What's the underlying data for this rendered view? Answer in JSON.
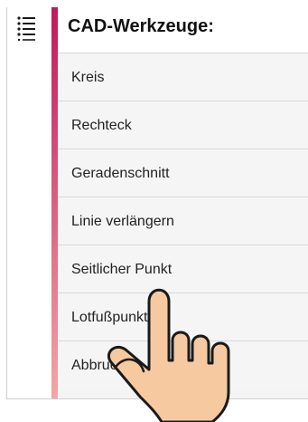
{
  "icons": {
    "menu": "list-menu-icon",
    "pointer": "hand-pointer-icon"
  },
  "colors": {
    "accent_top": "#c2185b",
    "accent_bottom": "#f4a6a6",
    "hand_fill": "#f6c9a0",
    "hand_stroke": "#1a1a1a"
  },
  "panel": {
    "title": "CAD-Werkzeuge:",
    "items": [
      {
        "label": "Kreis"
      },
      {
        "label": "Rechteck"
      },
      {
        "label": "Geradenschnitt"
      },
      {
        "label": "Linie verlängern"
      },
      {
        "label": "Seitlicher Punkt"
      },
      {
        "label": "Lotfußpunkt"
      },
      {
        "label": "Abbruch"
      }
    ]
  }
}
